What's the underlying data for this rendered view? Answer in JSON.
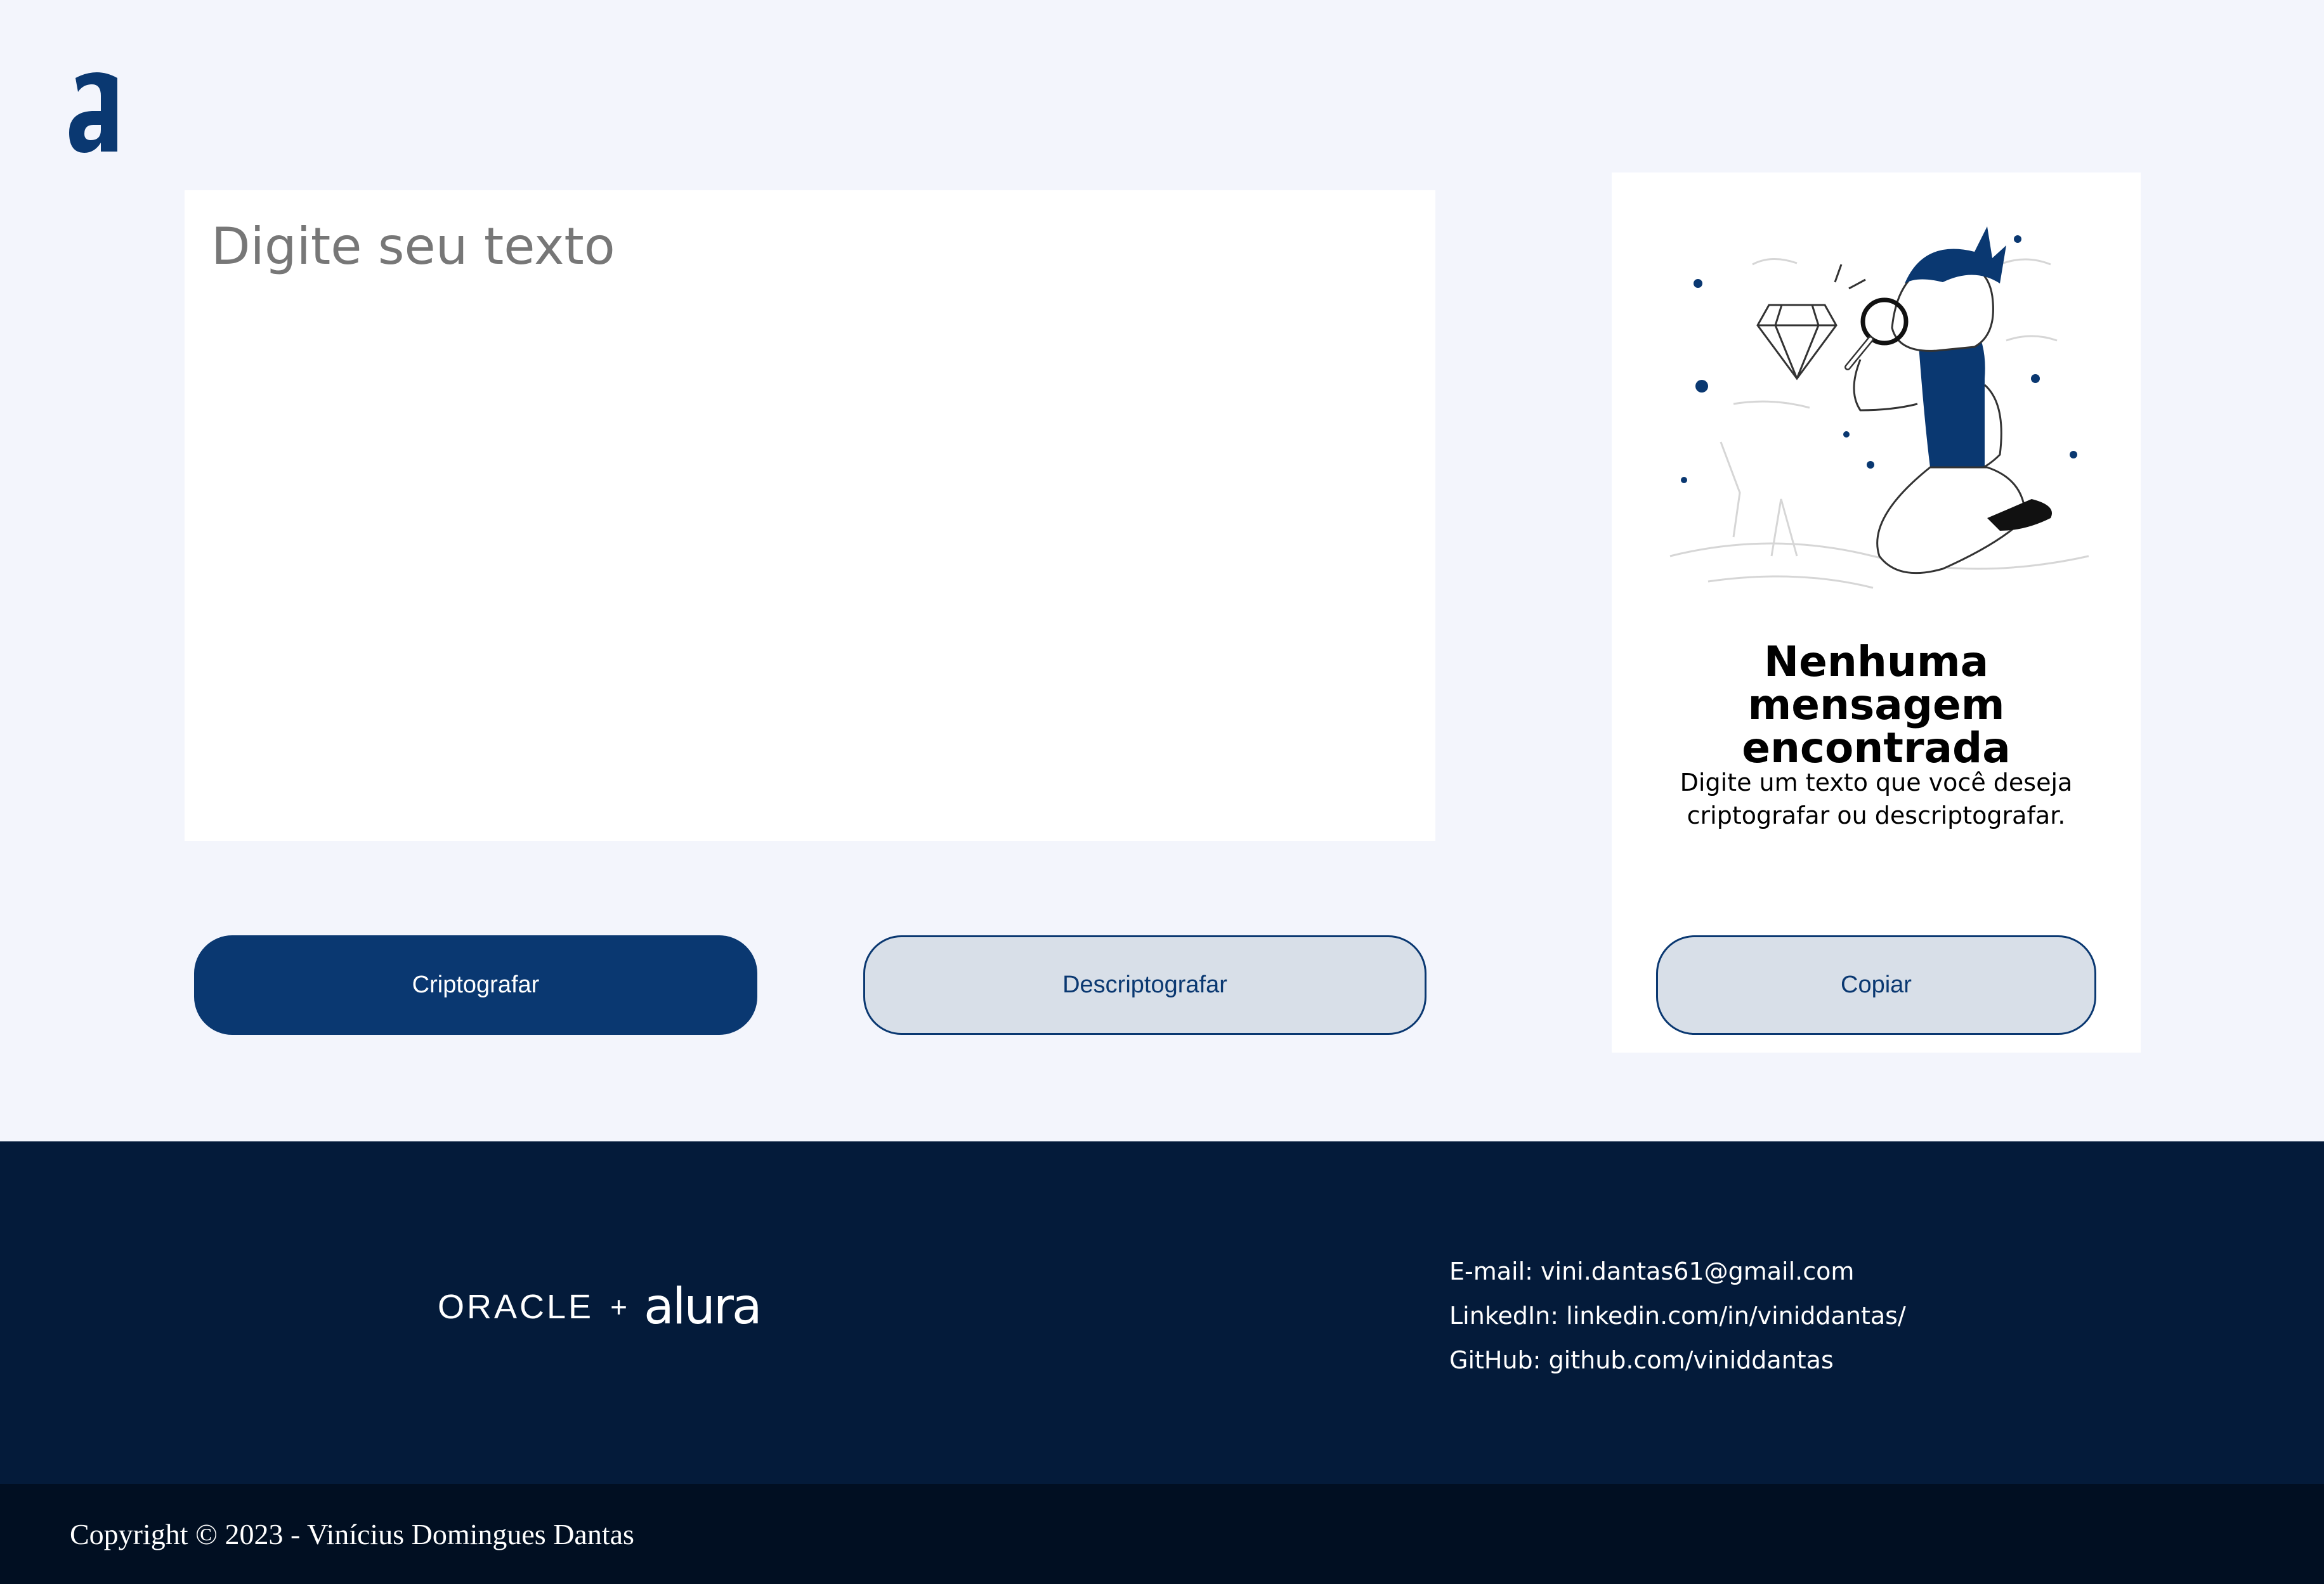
{
  "header": {
    "logo_icon": "alura-a-logo",
    "brand_color": "#0A3871"
  },
  "editor": {
    "placeholder": "Digite seu texto",
    "value": ""
  },
  "actions": {
    "encrypt_label": "Criptografar",
    "decrypt_label": "Descriptografar"
  },
  "result": {
    "illustration_icon": "boy-with-magnifying-glass-illustration",
    "title": "Nenhuma mensagem encontrada",
    "description": "Digite um texto que você deseja criptografar ou descriptografar.",
    "copy_label": "Copiar"
  },
  "footer": {
    "partner_oracle": "ORACLE",
    "partner_plus": "+",
    "partner_alura": "alura",
    "email": "E-mail: vini.dantas61@gmail.com",
    "linkedin": "LinkedIn: linkedin.com/in/viniddantas/",
    "github": "GitHub: github.com/viniddantas",
    "copyright": "Copyright © 2023 - Vinícius Domingues Dantas"
  },
  "colors": {
    "background": "#F3F5FC",
    "primary": "#0A3871",
    "secondary_bg": "#D8DFE8",
    "footer_bg": "#041B3A",
    "copyright_bg": "#010F22"
  }
}
